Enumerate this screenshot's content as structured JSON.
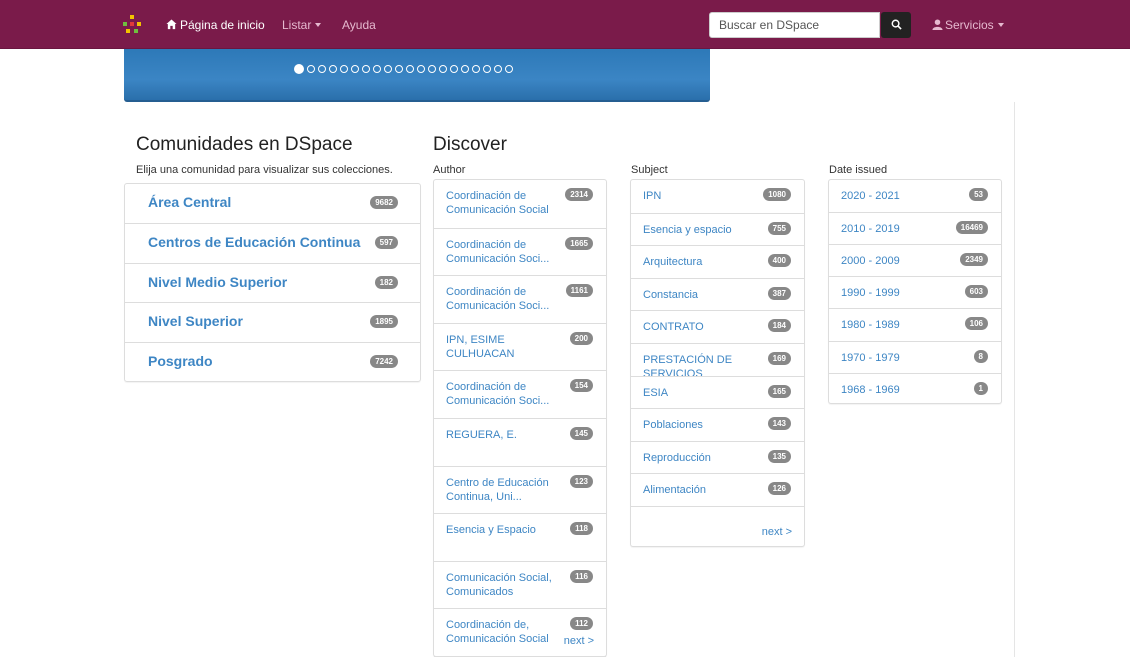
{
  "nav": {
    "home_label": "Página de inicio",
    "browse_label": "Listar",
    "help_label": "Ayuda",
    "search_placeholder": "Buscar en DSpace",
    "services_label": "Servicios",
    "brand_color": "#7a1b4a"
  },
  "carousel": {
    "dot_count": 20,
    "active_index": 0
  },
  "communities": {
    "title": "Comunidades en DSpace",
    "subtitle": "Elija una comunidad para visualizar sus colecciones.",
    "items": [
      {
        "label": "Área Central",
        "count": "9682"
      },
      {
        "label": "Centros de Educación Continua",
        "count": "597"
      },
      {
        "label": "Nivel Medio Superior",
        "count": "182"
      },
      {
        "label": "Nivel Superior",
        "count": "1895"
      },
      {
        "label": "Posgrado",
        "count": "7242"
      }
    ]
  },
  "discover": {
    "title": "Discover",
    "author": {
      "title": "Author",
      "next": "next >",
      "items": [
        {
          "label": "Coordinación de Comunicación Social",
          "count": "2314"
        },
        {
          "label": "Coordinación de Comunicación Soci...",
          "count": "1665"
        },
        {
          "label": "Coordinación de Comunicación Soci...",
          "count": "1161"
        },
        {
          "label": "IPN, ESIME CULHUACAN",
          "count": "200"
        },
        {
          "label": "Coordinación de Comunicación Soci...",
          "count": "154"
        },
        {
          "label": "REGUERA, E.",
          "count": "145"
        },
        {
          "label": "Centro de Educación Continua, Uni...",
          "count": "123"
        },
        {
          "label": "Esencia y Espacio",
          "count": "118"
        },
        {
          "label": "Comunicación Social, Comunicados",
          "count": "116"
        },
        {
          "label": "Coordinación de, Comunicación Social",
          "count": "112"
        }
      ]
    },
    "subject": {
      "title": "Subject",
      "next": "next >",
      "items": [
        {
          "label": "IPN",
          "count": "1080"
        },
        {
          "label": "Esencia y espacio",
          "count": "755"
        },
        {
          "label": "Arquitectura",
          "count": "400"
        },
        {
          "label": "Constancia",
          "count": "387"
        },
        {
          "label": "CONTRATO",
          "count": "184"
        },
        {
          "label": "PRESTACIÓN DE SERVICIOS",
          "count": "169"
        },
        {
          "label": "ESIA",
          "count": "165"
        },
        {
          "label": "Poblaciones",
          "count": "143"
        },
        {
          "label": "Reproducción",
          "count": "135"
        },
        {
          "label": "Alimentación",
          "count": "126"
        }
      ]
    },
    "date": {
      "title": "Date issued",
      "items": [
        {
          "label": "2020 - 2021",
          "count": "53"
        },
        {
          "label": "2010 - 2019",
          "count": "16469"
        },
        {
          "label": "2000 - 2009",
          "count": "2349"
        },
        {
          "label": "1990 - 1999",
          "count": "603"
        },
        {
          "label": "1980 - 1989",
          "count": "106"
        },
        {
          "label": "1970 - 1979",
          "count": "8"
        },
        {
          "label": "1968 - 1969",
          "count": "1"
        }
      ]
    }
  }
}
